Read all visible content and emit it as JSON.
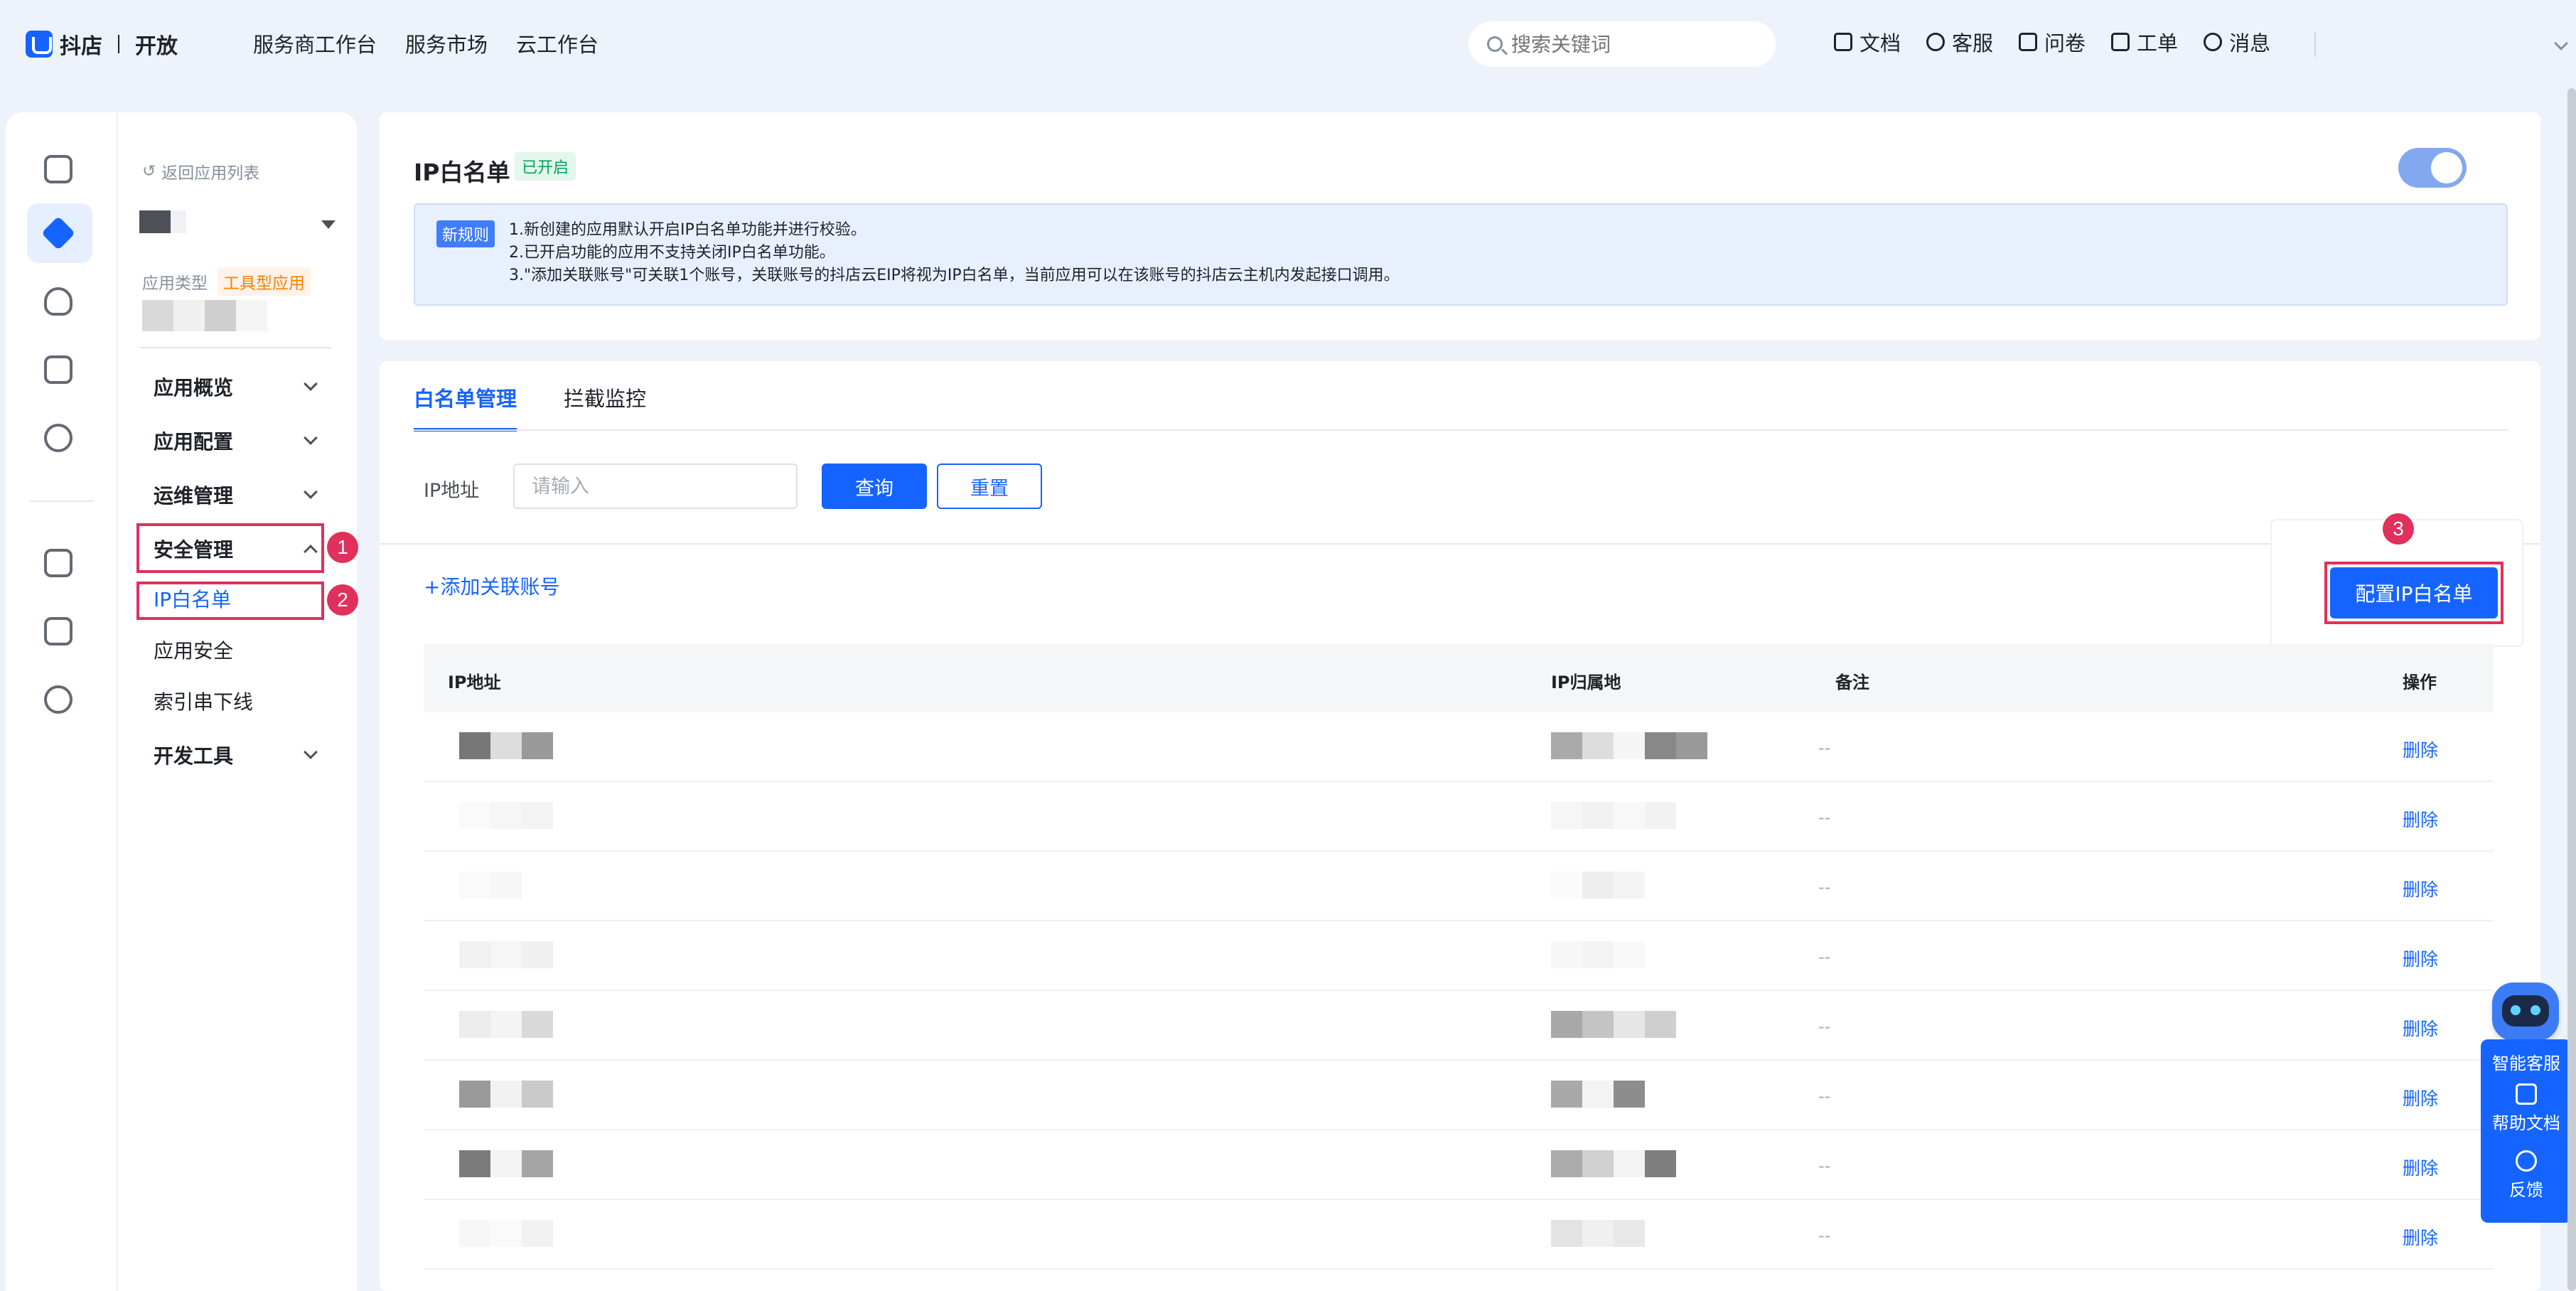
{
  "header": {
    "logo_text": "抖店",
    "logo_sub": "开放",
    "nav": [
      "服务商工作台",
      "服务市场",
      "云工作台"
    ],
    "search_placeholder": "搜索关键词",
    "actions": [
      "文档",
      "客服",
      "问卷",
      "工单",
      "消息"
    ]
  },
  "sidebar": {
    "back_label": "返回应用列表",
    "app_type_label": "应用类型",
    "app_type_value": "工具型应用",
    "menu": {
      "overview": "应用概览",
      "config": "应用配置",
      "ops": "运维管理",
      "security": "安全管理",
      "ip_whitelist": "IP白名单",
      "app_security": "应用安全",
      "index_offline": "索引串下线",
      "dev_tools": "开发工具"
    }
  },
  "annotations": {
    "one": "1",
    "two": "2",
    "three": "3"
  },
  "whitelist": {
    "title": "IP白名单",
    "status": "已开启",
    "enabled": true,
    "notice_tag": "新规则",
    "notice_lines": [
      "1.新创建的应用默认开启IP白名单功能并进行校验。",
      "2.已开启功能的应用不支持关闭IP白名单功能。",
      "3.\"添加关联账号\"可关联1个账号，关联账号的抖店云EIP将视为IP白名单，当前应用可以在该账号的抖店云主机内发起接口调用。"
    ]
  },
  "tabs": [
    "白名单管理",
    "拦截监控"
  ],
  "filter": {
    "label": "IP地址",
    "placeholder": "请输入",
    "query_button": "查询",
    "reset_button": "重置"
  },
  "add_link": "+添加关联账号",
  "config_button": "配置IP白名单",
  "table": {
    "columns": [
      "IP地址",
      "IP归属地",
      "备注",
      "操作"
    ],
    "rows": [
      {
        "remark": "--",
        "action": "删除"
      },
      {
        "remark": "--",
        "action": "删除"
      },
      {
        "remark": "--",
        "action": "删除"
      },
      {
        "remark": "--",
        "action": "删除"
      },
      {
        "remark": "--",
        "action": "删除"
      },
      {
        "remark": "--",
        "action": "删除"
      },
      {
        "remark": "--",
        "action": "删除"
      },
      {
        "remark": "--",
        "action": "删除"
      }
    ]
  },
  "helper": {
    "ai_service": "智能客服",
    "help_docs": "帮助文档",
    "feedback": "反馈"
  },
  "colors": {
    "primary": "#1664ff",
    "highlight": "#e0305c",
    "success": "#00a35c",
    "warning": "#ff7d00"
  }
}
